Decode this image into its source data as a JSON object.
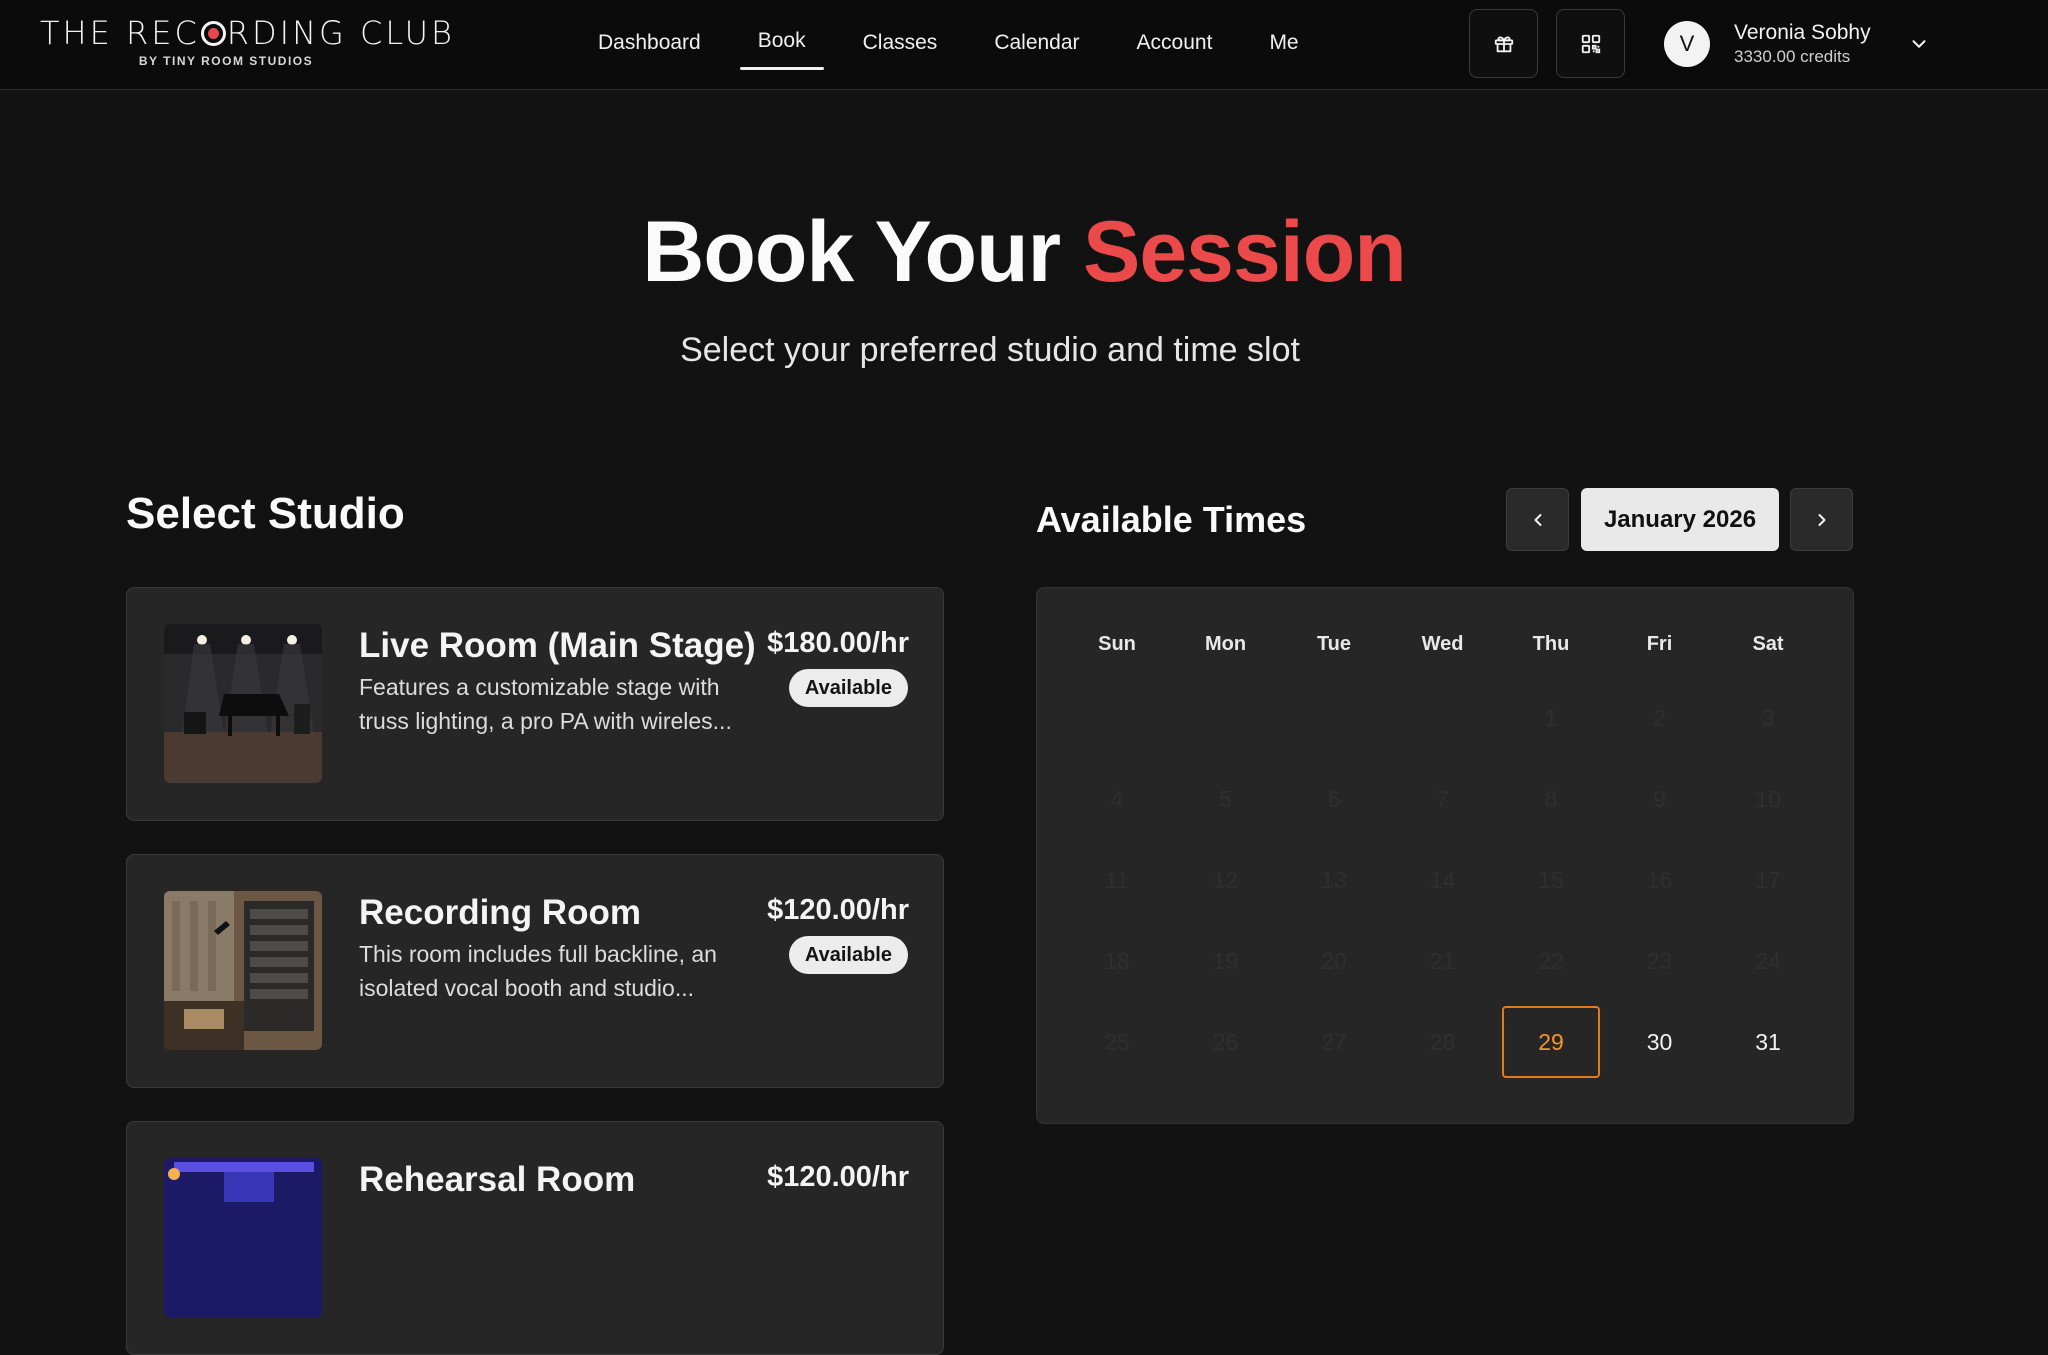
{
  "brand": {
    "name_before": "THE REC",
    "name_after": "RDING CLUB",
    "subtitle": "BY TINY ROOM STUDIOS"
  },
  "nav": {
    "items": [
      {
        "label": "Dashboard",
        "active": false
      },
      {
        "label": "Book",
        "active": true
      },
      {
        "label": "Classes",
        "active": false
      },
      {
        "label": "Calendar",
        "active": false
      },
      {
        "label": "Account",
        "active": false
      },
      {
        "label": "Me",
        "active": false
      }
    ]
  },
  "header_actions": {
    "gift_icon": "gift-icon",
    "qr_icon": "qr-code-icon"
  },
  "user": {
    "initial": "V",
    "name": "Veronia Sobhy",
    "credits": "3330.00 credits"
  },
  "hero": {
    "title_plain": "Book Your ",
    "title_accent": "Session",
    "subtitle": "Select your preferred studio and time slot"
  },
  "studios": {
    "heading": "Select Studio",
    "items": [
      {
        "name": "Live Room (Main Stage)",
        "description": "Features a customizable stage with truss lighting, a pro PA with wireles...",
        "price": "$180.00/hr",
        "status": "Available"
      },
      {
        "name": "Recording Room",
        "description": "This room includes full backline, an isolated vocal booth and studio...",
        "price": "$120.00/hr",
        "status": "Available"
      },
      {
        "name": "Rehearsal Room",
        "description": "",
        "price": "$120.00/hr",
        "status": ""
      }
    ]
  },
  "calendar": {
    "heading": "Available Times",
    "month": "January 2026",
    "prev_icon": "chevron-left-icon",
    "next_icon": "chevron-right-icon",
    "weekdays": [
      "Sun",
      "Mon",
      "Tue",
      "Wed",
      "Thu",
      "Fri",
      "Sat"
    ],
    "first_weekday_index": 4,
    "days_in_month": 31,
    "selected_day": 29,
    "available_days": [
      29,
      30,
      31
    ]
  },
  "colors": {
    "accent_red": "#ec4a4a",
    "selected_orange": "#f3962b",
    "background": "#121212",
    "card": "#262626"
  }
}
